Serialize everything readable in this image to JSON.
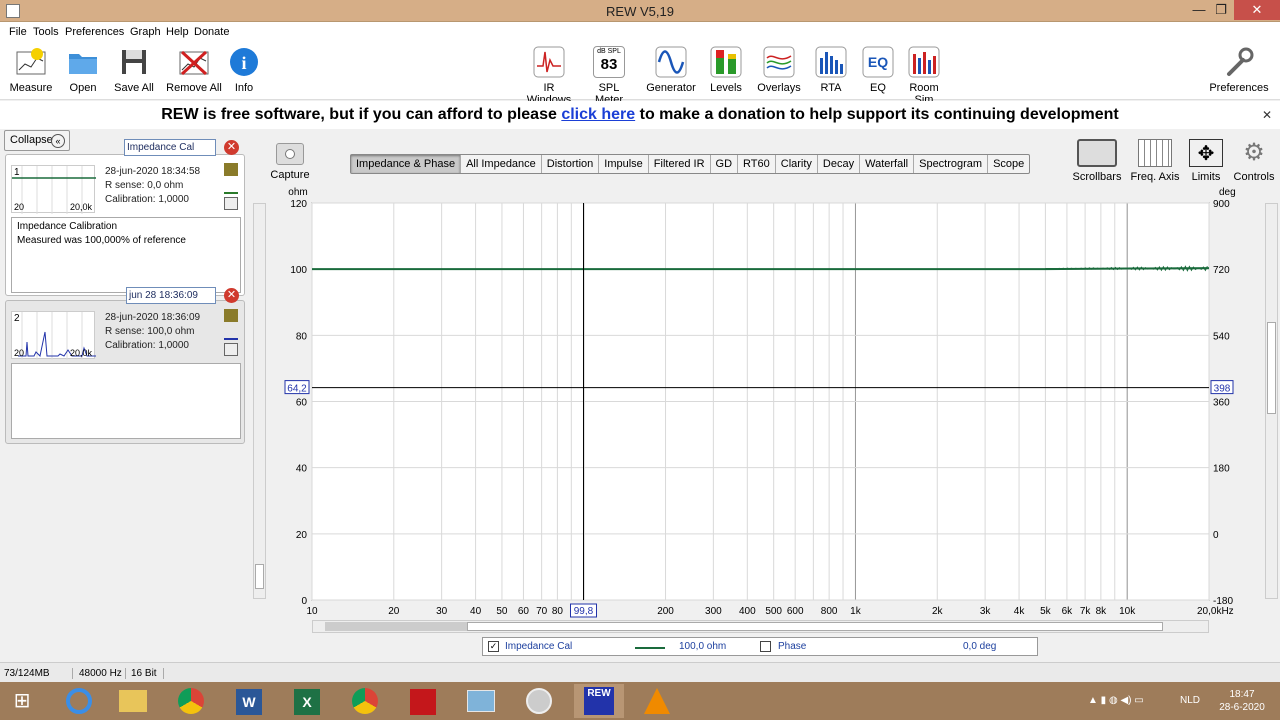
{
  "window": {
    "title": "REW V5,19",
    "minimize": "—",
    "restore": "❐",
    "close": "✕"
  },
  "menu": [
    "File",
    "Tools",
    "Preferences",
    "Graph",
    "Help",
    "Donate"
  ],
  "toolbar": {
    "left": [
      {
        "label": "Measure",
        "icon": "measure-icon"
      },
      {
        "label": "Open",
        "icon": "folder-icon"
      },
      {
        "label": "Save All",
        "icon": "save-icon"
      },
      {
        "label": "Remove All",
        "icon": "remove-icon"
      },
      {
        "label": "Info",
        "icon": "info-icon"
      }
    ],
    "center": [
      {
        "label": "IR Windows",
        "icon": "ir-windows-icon"
      },
      {
        "label": "SPL Meter",
        "icon": "spl-meter-icon",
        "badge_top": "dB SPL",
        "badge_value": "83"
      },
      {
        "label": "Generator",
        "icon": "generator-icon"
      },
      {
        "label": "Levels",
        "icon": "levels-icon"
      },
      {
        "label": "Overlays",
        "icon": "overlays-icon"
      },
      {
        "label": "RTA",
        "icon": "rta-icon"
      },
      {
        "label": "EQ",
        "icon": "eq-icon"
      },
      {
        "label": "Room Sim",
        "icon": "room-sim-icon"
      }
    ],
    "right": {
      "label": "Preferences",
      "icon": "wrench-icon"
    }
  },
  "banner": {
    "pre": "REW is free software, but if you can afford to please",
    "link": "click here",
    "post": "to make a donation to help support its continuing development",
    "close": "✕"
  },
  "left_panel": {
    "collapse": "Collapse",
    "measurements": [
      {
        "index": "1",
        "name": "Impedance Cal",
        "date": "28-jun-2020 18:34:58",
        "r_sense": "R sense: 0,0 ohm",
        "calibration": "Calibration: 1,0000",
        "thumb_min": "20",
        "thumb_max": "20,0k",
        "notes": [
          "Impedance Calibration",
          "Measured was 100,000% of reference"
        ]
      },
      {
        "index": "2",
        "name": "jun 28 18:36:09",
        "date": "28-jun-2020 18:36:09",
        "r_sense": "R sense: 100,0 ohm",
        "calibration": "Calibration: 1,0000",
        "thumb_min": "20",
        "thumb_max": "20,0k",
        "notes": []
      }
    ]
  },
  "graph": {
    "capture": "Capture",
    "tabs": [
      "Impedance & Phase",
      "All Impedance",
      "Distortion",
      "Impulse",
      "Filtered IR",
      "GD",
      "RT60",
      "Clarity",
      "Decay",
      "Waterfall",
      "Spectrogram",
      "Scope"
    ],
    "selected_tab": "Impedance & Phase",
    "right_tools": [
      "Scrollbars",
      "Freq. Axis",
      "Limits",
      "Controls"
    ],
    "cursor_left": "64,2",
    "cursor_right": "398",
    "cursor_x": "99,8"
  },
  "chart_data": {
    "type": "line",
    "xlabel": "Hz",
    "ylabel": "ohm",
    "y2label": "deg",
    "xscale": "log",
    "xlim": [
      10,
      20000
    ],
    "ylim": [
      0,
      120
    ],
    "y2lim": [
      -180,
      900
    ],
    "x_ticks": [
      "10",
      "20",
      "30",
      "40",
      "50",
      "60",
      "70",
      "80",
      "200",
      "300",
      "400",
      "500",
      "600",
      "800",
      "1k",
      "2k",
      "3k",
      "4k",
      "5k",
      "6k",
      "7k",
      "8k",
      "10k",
      "20,0kHz"
    ],
    "x_tick_values": [
      10,
      20,
      30,
      40,
      50,
      60,
      70,
      80,
      200,
      300,
      400,
      500,
      600,
      800,
      1000,
      2000,
      3000,
      4000,
      5000,
      6000,
      7000,
      8000,
      10000,
      20000
    ],
    "y_ticks": [
      0,
      20,
      40,
      60,
      80,
      100,
      120
    ],
    "y2_ticks": [
      -180,
      0,
      180,
      360,
      540,
      720,
      900
    ],
    "grid": true,
    "series": [
      {
        "name": "Impedance Cal",
        "color": "#1a6b3c",
        "x": [
          10,
          100,
          1000,
          5000,
          10000,
          20000
        ],
        "y": [
          100,
          100,
          100,
          100,
          100.2,
          100.3
        ]
      }
    ]
  },
  "legend": {
    "series_name": "Impedance Cal",
    "value": "100,0 ohm",
    "phase_label": "Phase",
    "phase_value": "0,0 deg"
  },
  "status": {
    "memory": "73/124MB",
    "rate": "48000 Hz",
    "bits": "16 Bit"
  },
  "taskbar": {
    "lang": "NLD",
    "time": "18:47",
    "date": "28-6-2020"
  },
  "colors": {
    "titlebar": "#d6ae87",
    "taskbar": "#9e7c5a",
    "trace": "#1a6b3c",
    "link": "#1b3fd6"
  }
}
